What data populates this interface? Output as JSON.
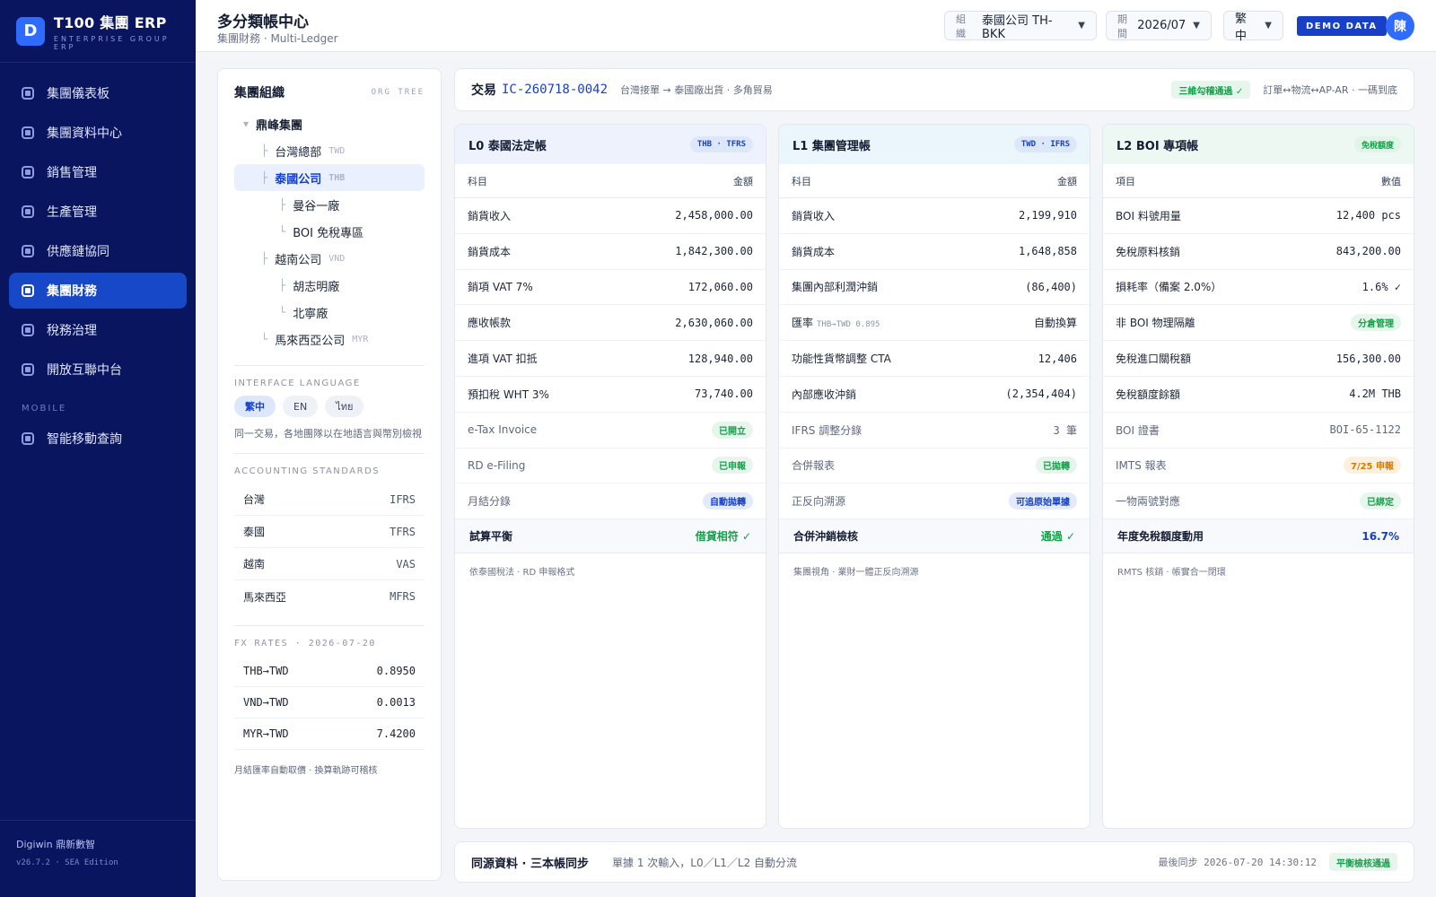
{
  "sidebar": {
    "logo_letter": "D",
    "brand_title": "T100 集團 ERP",
    "brand_sub": "ENTERPRISE GROUP ERP",
    "items": [
      {
        "label": "集團儀表板",
        "active": false
      },
      {
        "label": "集團資料中心",
        "active": false
      },
      {
        "label": "銷售管理",
        "active": false
      },
      {
        "label": "生產管理",
        "active": false
      },
      {
        "label": "供應鏈協同",
        "active": false
      },
      {
        "label": "集團財務",
        "active": true
      },
      {
        "label": "稅務治理",
        "active": false
      },
      {
        "label": "開放互聯中台",
        "active": false
      }
    ],
    "section_mobile": "MOBILE",
    "mobile_items": [
      {
        "label": "智能移動查詢"
      }
    ],
    "footer_company": "Digiwin 鼎新數智",
    "footer_version": "v26.7.2 · SEA Edition"
  },
  "header": {
    "title": "多分類帳中心",
    "subtitle": "集團財務 · Multi-Ledger",
    "org_label": "組織",
    "org_value": "泰國公司 TH-BKK",
    "period_label": "期間",
    "period_value": "2026/07",
    "lang_value": "繁中",
    "caret": "▼",
    "demo_badge": "DEMO DATA",
    "avatar": "陳"
  },
  "left_panel": {
    "org_title": "集團組織",
    "org_tag": "ORG TREE",
    "tree": [
      {
        "label": "鼎峰集團",
        "currency": "",
        "level": 0,
        "guide": "▾",
        "selected": false,
        "bold": true
      },
      {
        "label": "台灣總部",
        "currency": "TWD",
        "level": 1,
        "guide": "├",
        "selected": false,
        "bold": false
      },
      {
        "label": "泰國公司",
        "currency": "THB",
        "level": 1,
        "guide": "├",
        "selected": true,
        "bold": true
      },
      {
        "label": "曼谷一廠",
        "currency": "",
        "level": 2,
        "guide": "├",
        "selected": false,
        "bold": false
      },
      {
        "label": "BOI 免稅專區",
        "currency": "",
        "level": 2,
        "guide": "└",
        "selected": false,
        "bold": false
      },
      {
        "label": "越南公司",
        "currency": "VND",
        "level": 1,
        "guide": "├",
        "selected": false,
        "bold": false
      },
      {
        "label": "胡志明廠",
        "currency": "",
        "level": 2,
        "guide": "├",
        "selected": false,
        "bold": false
      },
      {
        "label": "北寧廠",
        "currency": "",
        "level": 2,
        "guide": "└",
        "selected": false,
        "bold": false
      },
      {
        "label": "馬來西亞公司",
        "currency": "MYR",
        "level": 1,
        "guide": "└",
        "selected": false,
        "bold": false
      }
    ],
    "lang_section": "INTERFACE LANGUAGE",
    "languages": [
      {
        "label": "繁中",
        "active": true
      },
      {
        "label": "EN",
        "active": false
      },
      {
        "label": "ไทย",
        "active": false
      }
    ],
    "lang_note": "同一交易，各地團隊以在地語言與幣別檢視",
    "standards_section": "ACCOUNTING STANDARDS",
    "standards": [
      {
        "country": "台灣",
        "std": "IFRS"
      },
      {
        "country": "泰國",
        "std": "TFRS"
      },
      {
        "country": "越南",
        "std": "VAS"
      },
      {
        "country": "馬來西亞",
        "std": "MFRS"
      }
    ],
    "fx_section": "FX RATES · 2026-07-20",
    "fx": [
      {
        "pair": "THB→TWD",
        "rate": "0.8950"
      },
      {
        "pair": "VND→TWD",
        "rate": "0.0013"
      },
      {
        "pair": "MYR→TWD",
        "rate": "7.4200"
      }
    ],
    "fx_note": "月結匯率自動取價 · 換算軌跡可稽核"
  },
  "transaction": {
    "label": "交易",
    "id": "IC-260718-0042",
    "desc": "台灣接單 → 泰國廠出貨 · 多角貿易",
    "badge": "三維勾稽通過 ✓",
    "note": "訂單↔物流↔AP-AR · 一碼到底"
  },
  "ledgers": [
    {
      "title": "L0 泰國法定帳",
      "tag": "THB · TFRS",
      "tag_style": "blue",
      "head_bg": "#eef2fc",
      "col_left": "科目",
      "col_right": "金額",
      "rows": [
        {
          "name": "銷貨收入",
          "value": "2,458,000.00",
          "type": "mono"
        },
        {
          "name": "銷貨成本",
          "value": "1,842,300.00",
          "type": "mono"
        },
        {
          "name": "銷項 VAT 7%",
          "value": "172,060.00",
          "type": "mono"
        },
        {
          "name": "應收帳款",
          "value": "2,630,060.00",
          "type": "mono"
        },
        {
          "name": "進項 VAT 扣抵",
          "value": "128,940.00",
          "type": "mono"
        },
        {
          "name": "預扣稅 WHT 3%",
          "value": "73,740.00",
          "type": "mono"
        },
        {
          "name": "e-Tax Invoice",
          "value": "已開立",
          "type": "pill-green",
          "dim": true
        },
        {
          "name": "RD e-Filing",
          "value": "已申報",
          "type": "pill-green",
          "dim": true
        },
        {
          "name": "月結分錄",
          "value": "自動拋轉",
          "type": "pill-blue",
          "dim": true
        }
      ],
      "sum_name": "試算平衡",
      "sum_value": "借貸相符 ✓",
      "sum_color": "#16a04a",
      "footer": "依泰國稅法 · RD 申報格式"
    },
    {
      "title": "L1 集團管理帳",
      "tag": "TWD · IFRS",
      "tag_style": "blue",
      "head_bg": "#eaf5fc",
      "col_left": "科目",
      "col_right": "金額",
      "rows": [
        {
          "name": "銷貨收入",
          "value": "2,199,910",
          "type": "mono"
        },
        {
          "name": "銷貨成本",
          "value": "1,648,858",
          "type": "mono"
        },
        {
          "name": "集團內部利潤沖銷",
          "value": "(86,400)",
          "type": "mono"
        },
        {
          "name": "匯率",
          "sub": "THB→TWD 0.895",
          "value": "自動換算",
          "type": "text"
        },
        {
          "name": "功能性貨幣調整 CTA",
          "value": "12,406",
          "type": "mono"
        },
        {
          "name": "內部應收沖銷",
          "value": "(2,354,404)",
          "type": "mono"
        },
        {
          "name": "IFRS 調整分錄",
          "value": "3 筆",
          "type": "mono-dim",
          "dim": true
        },
        {
          "name": "合併報表",
          "value": "已拋轉",
          "type": "pill-green",
          "dim": true
        },
        {
          "name": "正反向溯源",
          "value": "可追原始單據",
          "type": "pill-blue",
          "dim": true
        }
      ],
      "sum_name": "合併沖銷檢核",
      "sum_value": "通過 ✓",
      "sum_color": "#16a04a",
      "footer": "集團視角 · 業財一體正反向溯源"
    },
    {
      "title": "L2 BOI 專項帳",
      "tag": "免稅額度",
      "tag_style": "green",
      "head_bg": "#eef8f2",
      "col_left": "項目",
      "col_right": "數值",
      "rows": [
        {
          "name": "BOI 料號用量",
          "value": "12,400 pcs",
          "type": "mono"
        },
        {
          "name": "免稅原料核銷",
          "value": "843,200.00",
          "type": "mono"
        },
        {
          "name": "損耗率（備案 2.0%）",
          "value": "1.6% ✓",
          "type": "mono"
        },
        {
          "name": "非 BOI 物理隔離",
          "value": "分倉管理",
          "type": "pill-green"
        },
        {
          "name": "免稅進口關稅額",
          "value": "156,300.00",
          "type": "mono"
        },
        {
          "name": "免稅額度餘額",
          "value": "4.2M THB",
          "type": "mono"
        },
        {
          "name": "BOI 證書",
          "value": "BOI-65-1122",
          "type": "mono-dim",
          "dim": true
        },
        {
          "name": "IMTS 報表",
          "value": "7/25 申報",
          "type": "pill-orange",
          "dim": true
        },
        {
          "name": "一物兩號對應",
          "value": "已綁定",
          "type": "pill-green",
          "dim": true
        }
      ],
      "sum_name": "年度免稅額度動用",
      "sum_value": "16.7%",
      "sum_color": "#1740c6",
      "footer": "RMTS 核銷 · 帳實合一閉環"
    }
  ],
  "footer_bar": {
    "title": "同源資料 · 三本帳同步",
    "desc": "單據 1 次輸入，L0／L1／L2 自動分流",
    "sync_label": "最後同步 2026-07-20 14:30:12",
    "badge": "平衡檢核通過"
  }
}
